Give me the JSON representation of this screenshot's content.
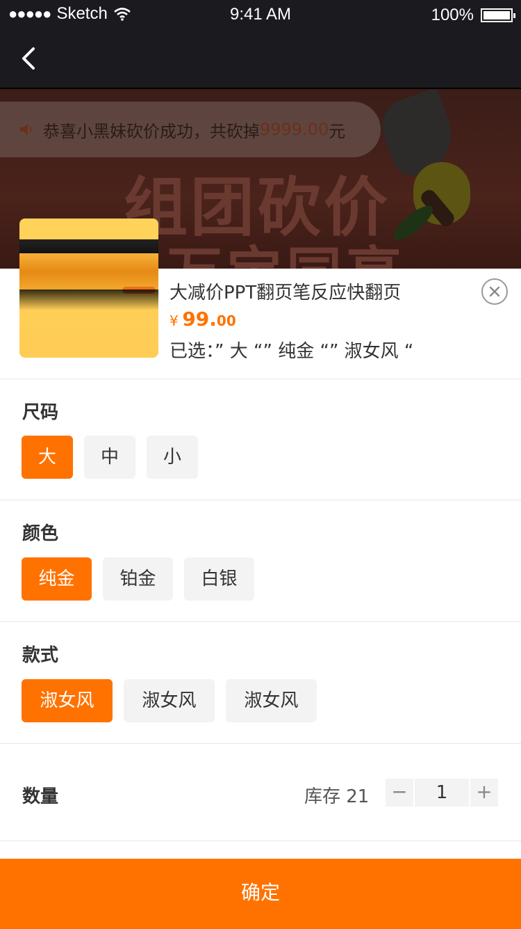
{
  "status_bar": {
    "signal": "●●●●●",
    "carrier": "Sketch",
    "time": "9:41 AM",
    "battery": "100%"
  },
  "banner": {
    "notice_text": "恭喜小黑妹砍价成功，共砍掉",
    "notice_amount": "9999.00",
    "notice_unit": "元",
    "title_line1": "组团砍价",
    "title_line2": "万宝同享"
  },
  "product": {
    "name": "大减价PPT翻页笔反应快翻页",
    "currency": "¥",
    "price_int": "99.",
    "price_dec": "00",
    "selected_text": "已选：” 大 “” 纯金 “” 淑女风 “"
  },
  "sections": [
    {
      "title": "尺码",
      "options": [
        "大",
        "中",
        "小"
      ],
      "selected": 0
    },
    {
      "title": "颜色",
      "options": [
        "纯金",
        "铂金",
        "白银"
      ],
      "selected": 0
    },
    {
      "title": "款式",
      "options": [
        "淑女风",
        "淑女风",
        "淑女风"
      ],
      "selected": 0
    }
  ],
  "quantity": {
    "label": "数量",
    "stock_text": "库存 21",
    "minus": "−",
    "value": "1",
    "plus": "+"
  },
  "confirm_label": "确定",
  "colors": {
    "accent": "#ff7200",
    "dark_bar": "#1b1b1f",
    "option_bg": "#f3f3f3"
  }
}
